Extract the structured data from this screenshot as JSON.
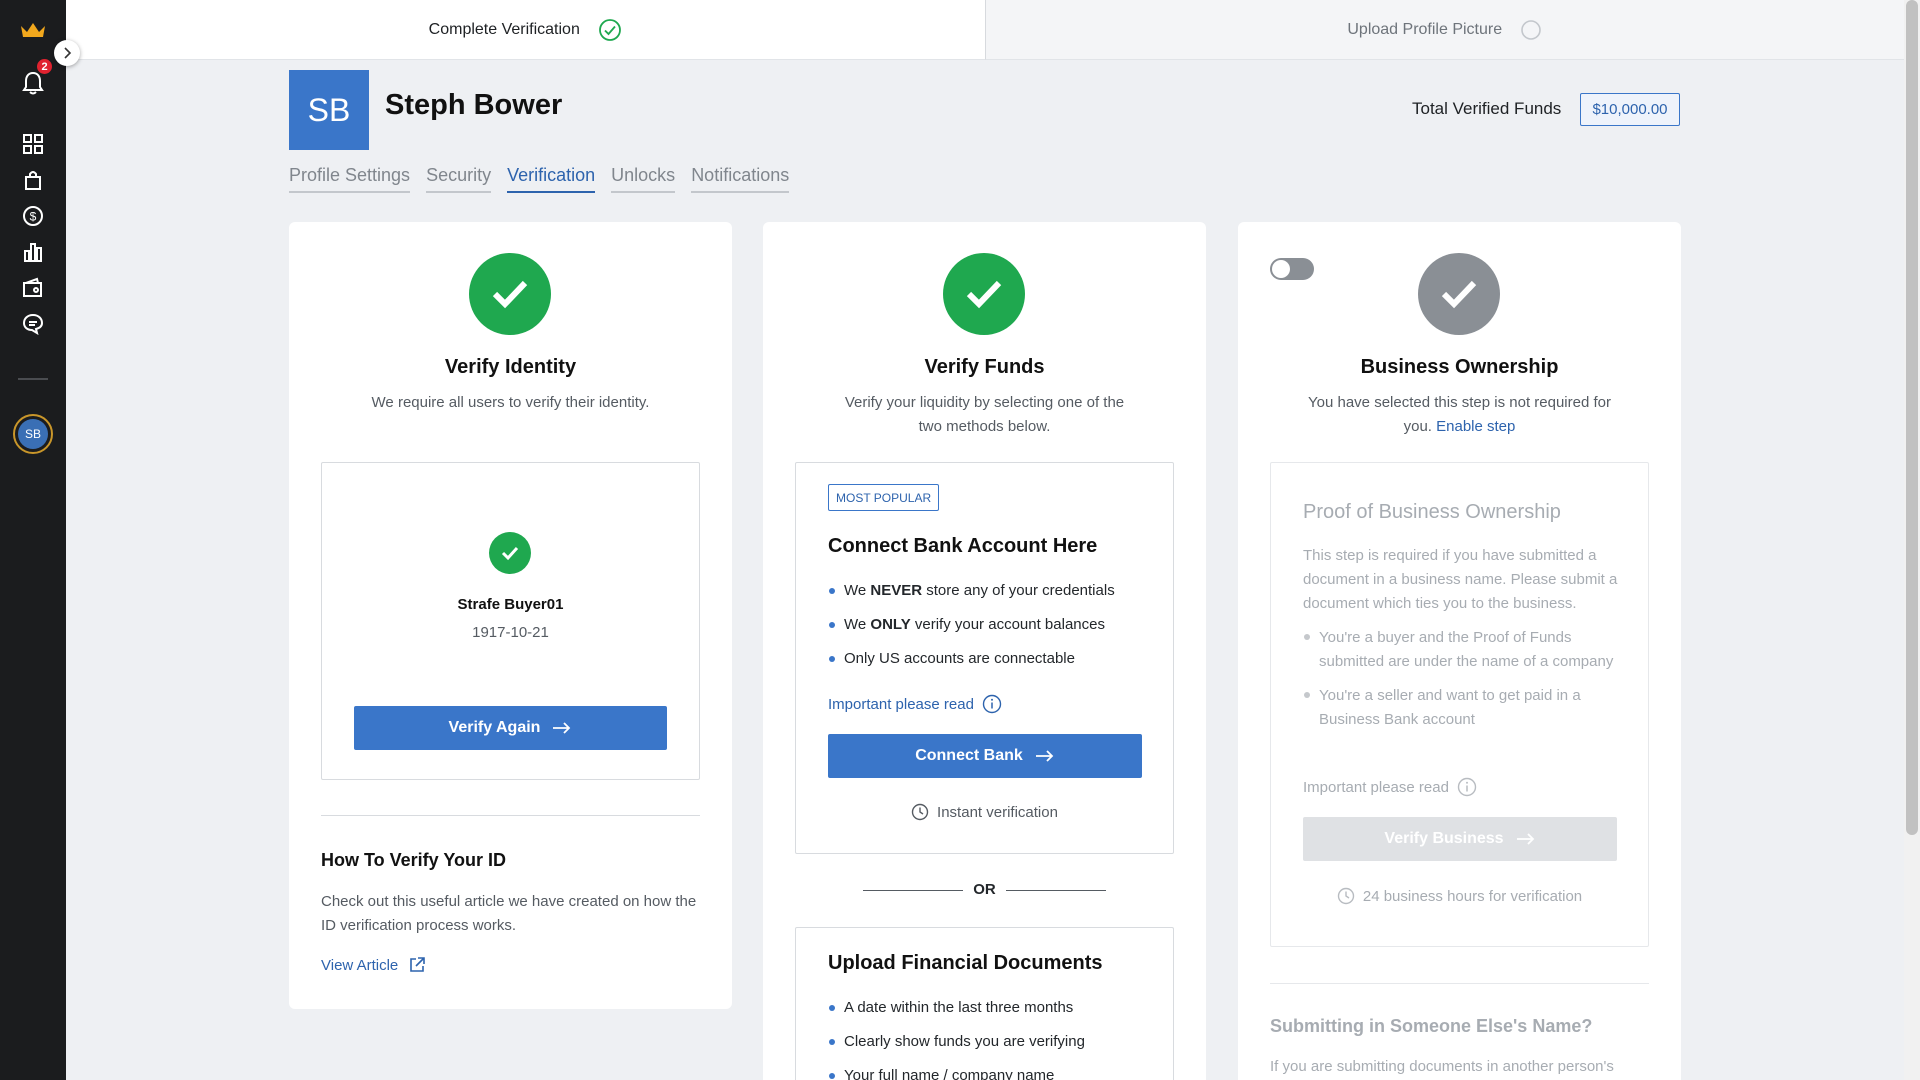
{
  "sidebar": {
    "notification_count": "2",
    "avatar_initials": "SB",
    "icons": [
      "crown-logo-icon",
      "bell-icon",
      "dashboard-grid-icon",
      "shopping-bag-icon",
      "dollar-circle-icon",
      "bar-chart-icon",
      "wallet-icon",
      "chat-icon"
    ]
  },
  "steps": [
    {
      "label": "Complete Verification",
      "done": true
    },
    {
      "label": "Upload Profile Picture",
      "done": false
    }
  ],
  "profile": {
    "initials": "SB",
    "name": "Steph Bower",
    "funds_label": "Total Verified Funds",
    "funds_value": "$10,000.00"
  },
  "tabs": [
    {
      "label": "Profile Settings",
      "active": false
    },
    {
      "label": "Security",
      "active": false
    },
    {
      "label": "Verification",
      "active": true
    },
    {
      "label": "Unlocks",
      "active": false
    },
    {
      "label": "Notifications",
      "active": false
    }
  ],
  "identity": {
    "title": "Verify Identity",
    "desc": "We require all users to verify their identity.",
    "user_name": "Strafe Buyer01",
    "date": "1917-10-21",
    "button": "Verify Again",
    "howto_title": "How To Verify Your ID",
    "howto_desc": "Check out this useful article we have created on how the ID verification process works.",
    "article_link": "View Article"
  },
  "funds": {
    "title": "Verify Funds",
    "desc": "Verify your liquidity by selecting one of the two methods below.",
    "tag": "MOST POPULAR",
    "bank_title": "Connect Bank Account Here",
    "bank_bullets": [
      {
        "pre": "We ",
        "bold": "NEVER",
        "post": " store any of your credentials"
      },
      {
        "pre": "We ",
        "bold": "ONLY",
        "post": " verify your account balances"
      },
      {
        "pre": "Only US accounts are connectable",
        "bold": "",
        "post": ""
      }
    ],
    "important": "Important please read",
    "bank_button": "Connect Bank",
    "instant": "Instant verification",
    "or": "OR",
    "docs_title": "Upload Financial Documents",
    "docs_bullets": [
      "A date within the last three months",
      "Clearly show funds you are verifying",
      "Your full name / company name"
    ]
  },
  "business": {
    "title": "Business Ownership",
    "desc_text": "You have selected this step is not required for you.",
    "enable_link": "Enable step",
    "toggle_on": false,
    "proof_title": "Proof of Business Ownership",
    "proof_desc": "This step is required if you have submitted a document in a business name. Please submit a document which ties you to the business.",
    "proof_bullets": [
      "You're a buyer and the Proof of Funds submitted are under the name of a company",
      "You're a seller and want to get paid in a Business Bank account"
    ],
    "important": "Important please read",
    "button": "Verify Business",
    "hours": "24 business hours for verification",
    "someone_title": "Submitting in Someone Else's Name?",
    "someone_desc": "If you are submitting documents in another person's"
  },
  "colors": {
    "accent": "#3a76c9",
    "success": "#1fa84f",
    "disabled": "#8a8f95"
  }
}
